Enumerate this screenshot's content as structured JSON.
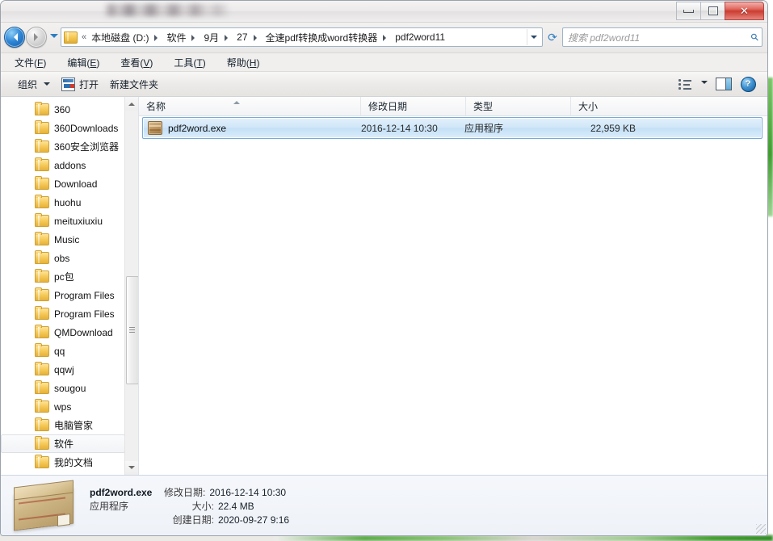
{
  "window": {
    "title_redacted": "",
    "controls": {
      "minimize": "最小化",
      "maximize": "最大化",
      "close": "✕"
    }
  },
  "nav": {
    "back_label": "后退",
    "forward_label": "前进",
    "history_label": "最近浏览的位置",
    "refresh_label": "刷新",
    "breadcrumbs": [
      "本地磁盘 (D:)",
      "软件",
      "9月",
      "27",
      "全速pdf转换成word转换器",
      "pdf2word11"
    ],
    "overflow_chevron": "«"
  },
  "search": {
    "placeholder": "搜索 pdf2word11",
    "icon": "search-icon"
  },
  "menubar": {
    "items": [
      {
        "text": "文件",
        "accel": "F"
      },
      {
        "text": "编辑",
        "accel": "E"
      },
      {
        "text": "查看",
        "accel": "V"
      },
      {
        "text": "工具",
        "accel": "T"
      },
      {
        "text": "帮助",
        "accel": "H"
      }
    ]
  },
  "toolbar": {
    "organize": "组织",
    "open": "打开",
    "new_folder": "新建文件夹",
    "view_options_label": "更改您的视图",
    "preview_pane_label": "显示预览窗格",
    "help_label": "?"
  },
  "sidebar": {
    "items": [
      {
        "label": "360",
        "selected": false
      },
      {
        "label": "360Downloads",
        "selected": false
      },
      {
        "label": "360安全浏览器",
        "selected": false
      },
      {
        "label": "addons",
        "selected": false
      },
      {
        "label": "Download",
        "selected": false
      },
      {
        "label": "huohu",
        "selected": false
      },
      {
        "label": "meituxiuxiu",
        "selected": false
      },
      {
        "label": "Music",
        "selected": false
      },
      {
        "label": "obs",
        "selected": false
      },
      {
        "label": "pc包",
        "selected": false
      },
      {
        "label": "Program Files",
        "selected": false
      },
      {
        "label": "Program Files",
        "selected": false
      },
      {
        "label": "QMDownload",
        "selected": false
      },
      {
        "label": "qq",
        "selected": false
      },
      {
        "label": "qqwj",
        "selected": false
      },
      {
        "label": "sougou",
        "selected": false
      },
      {
        "label": "wps",
        "selected": false
      },
      {
        "label": "电脑管家",
        "selected": false
      },
      {
        "label": "软件",
        "selected": true
      },
      {
        "label": "我的文档",
        "selected": false
      }
    ]
  },
  "filelist": {
    "columns": [
      {
        "label": "名称",
        "sorted": "asc"
      },
      {
        "label": "修改日期",
        "sorted": ""
      },
      {
        "label": "类型",
        "sorted": ""
      },
      {
        "label": "大小",
        "sorted": ""
      }
    ],
    "rows": [
      {
        "name": "pdf2word.exe",
        "modified": "2016-12-14 10:30",
        "type": "应用程序",
        "size": "22,959 KB",
        "icon": "executable-icon",
        "selected": true
      }
    ]
  },
  "details": {
    "file_name": "pdf2word.exe",
    "file_type": "应用程序",
    "modified_label": "修改日期:",
    "modified_value": "2016-12-14 10:30",
    "size_label": "大小:",
    "size_value": "22.4 MB",
    "created_label": "创建日期:",
    "created_value": "2020-09-27 9:16",
    "icon": "crate-package-icon"
  },
  "colors": {
    "selection_blue": "#cfe6f8",
    "selection_border": "#7aa9d4",
    "close_red": "#cc3c30",
    "folder_yellow": "#f6ca58",
    "accent_blue": "#2f7fc4"
  }
}
